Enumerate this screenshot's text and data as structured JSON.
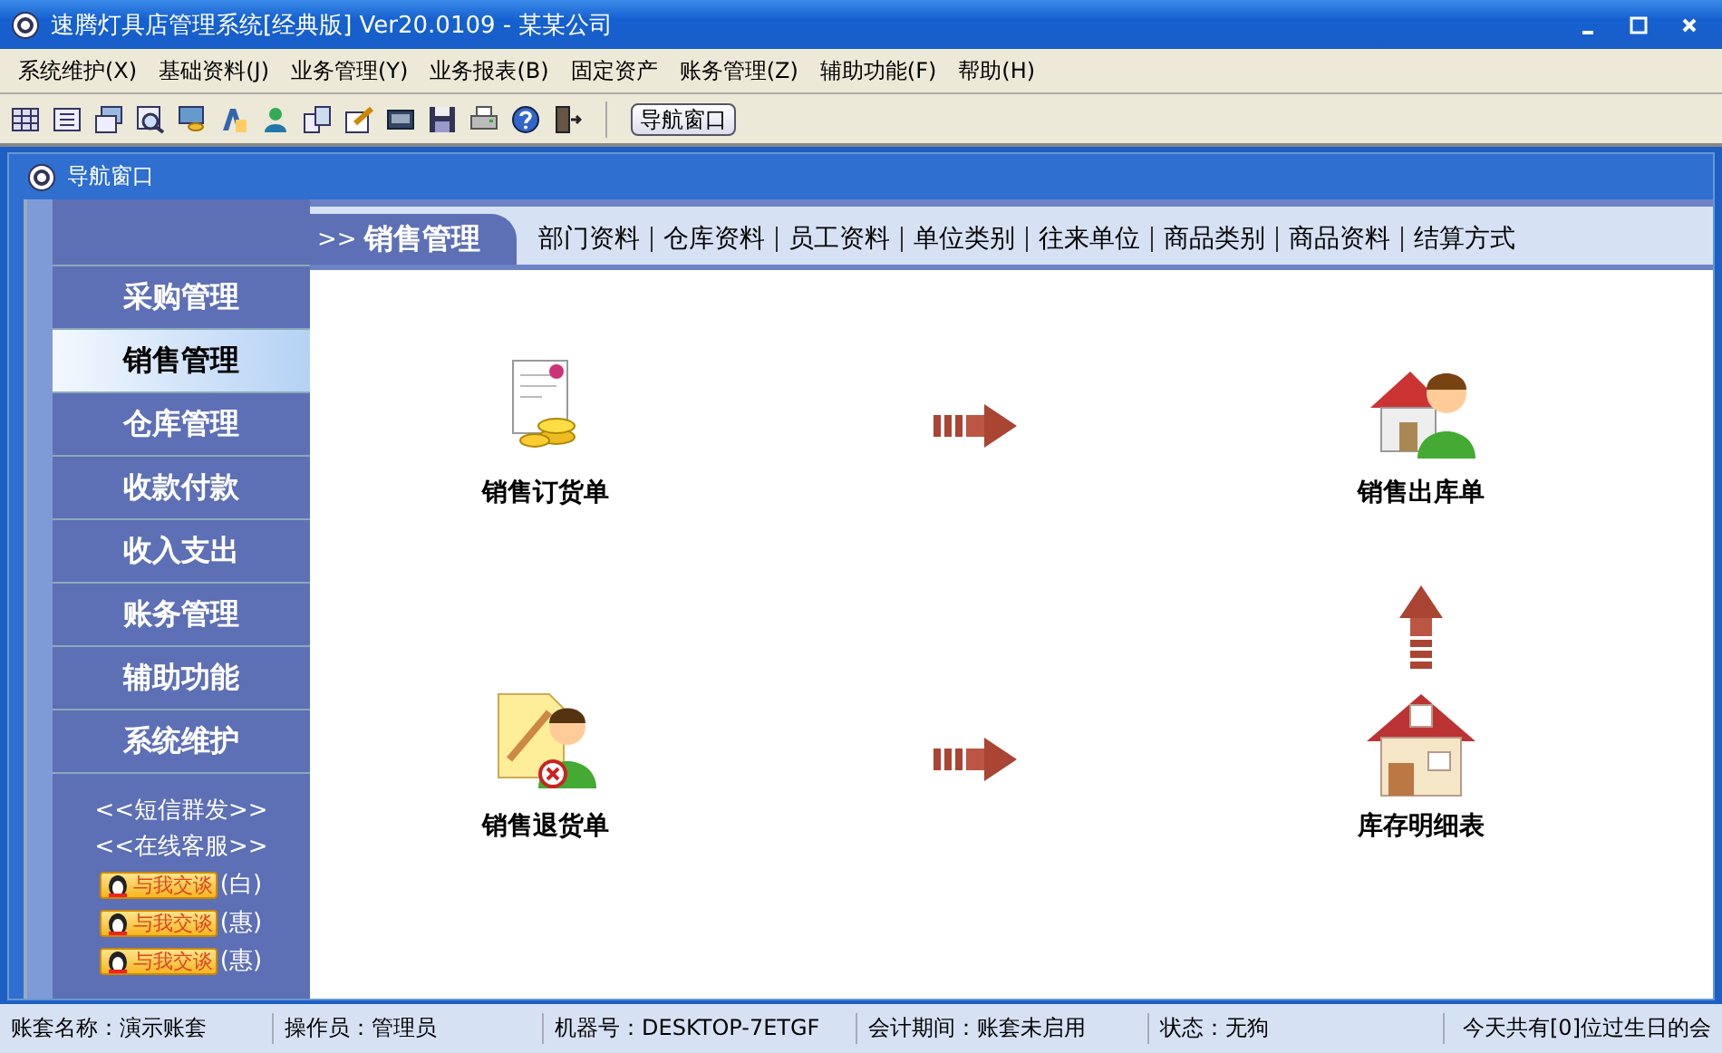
{
  "window": {
    "title": "速腾灯具店管理系统[经典版] Ver20.0109  -  某某公司"
  },
  "menu": [
    "系统维护(X)",
    "基础资料(J)",
    "业务管理(Y)",
    "业务报表(B)",
    "固定资产",
    "账务管理(Z)",
    "辅助功能(F)",
    "帮助(H)"
  ],
  "toolbar": {
    "nav_button": "导航窗口"
  },
  "inner_window": {
    "title": "导航窗口"
  },
  "sidebar": {
    "items": [
      {
        "label": "采购管理",
        "selected": false
      },
      {
        "label": "销售管理",
        "selected": true
      },
      {
        "label": "仓库管理",
        "selected": false
      },
      {
        "label": "收款付款",
        "selected": false
      },
      {
        "label": "收入支出",
        "selected": false
      },
      {
        "label": "账务管理",
        "selected": false
      },
      {
        "label": "辅助功能",
        "selected": false
      },
      {
        "label": "系统维护",
        "selected": false
      }
    ],
    "links": [
      "<<短信群发>>",
      "<<在线客服>>"
    ],
    "chat": [
      {
        "button": "与我交谈",
        "suffix": "(白)"
      },
      {
        "button": "与我交谈",
        "suffix": "(惠)"
      },
      {
        "button": "与我交谈",
        "suffix": "(惠)"
      }
    ]
  },
  "section": {
    "prefix": ">>",
    "title": "销售管理",
    "links": [
      "部门资料",
      "仓库资料",
      "员工资料",
      "单位类别",
      "往来单位",
      "商品类别",
      "商品资料",
      "结算方式"
    ]
  },
  "flow": [
    {
      "kind": "node",
      "label": "销售订货单"
    },
    {
      "kind": "arrow_right"
    },
    {
      "kind": "node",
      "label": "销售出库单"
    },
    {
      "kind": "blank"
    },
    {
      "kind": "blank"
    },
    {
      "kind": "arrow_up"
    },
    {
      "kind": "node",
      "label": "销售退货单"
    },
    {
      "kind": "arrow_right"
    },
    {
      "kind": "node",
      "label": "库存明细表"
    }
  ],
  "status_bar": [
    "账套名称：演示账套",
    "操作员：管理员",
    "机器号：DESKTOP-7ETGF",
    "会计期间：账套未启用",
    "状态：无狗",
    "今天共有[0]位过生日的会"
  ]
}
